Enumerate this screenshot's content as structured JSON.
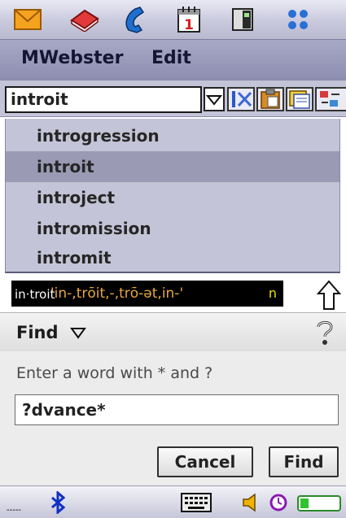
{
  "app_bar": {
    "icons": [
      "mail-icon",
      "book-icon",
      "phone-icon",
      "calendar-icon",
      "phone-memo-icon",
      "apps-grid-icon"
    ],
    "calendar_day": "1"
  },
  "menu": {
    "items": [
      "MWebster",
      "Edit"
    ]
  },
  "search": {
    "current_word": "introit"
  },
  "word_list": {
    "items": [
      "introgression",
      "introit",
      "introject",
      "intromission",
      "intromit"
    ],
    "selected_index": 1
  },
  "definition": {
    "headword": "in·troit",
    "pronunciation": "'in-,trōit,-,trō-ət,in-'",
    "trail": "n"
  },
  "find_dialog": {
    "title": "Find",
    "prompt": "Enter a word with * and ?",
    "input_value": "?dvance*",
    "cancel_label": "Cancel",
    "find_label": "Find"
  },
  "status_bar": {
    "left_text": "-----"
  },
  "colors": {
    "list_bg": "#c4c4d8",
    "selected_row": "#9a9ab4",
    "menubar": "#9a9abc",
    "pronunciation": "#e9a93d"
  }
}
